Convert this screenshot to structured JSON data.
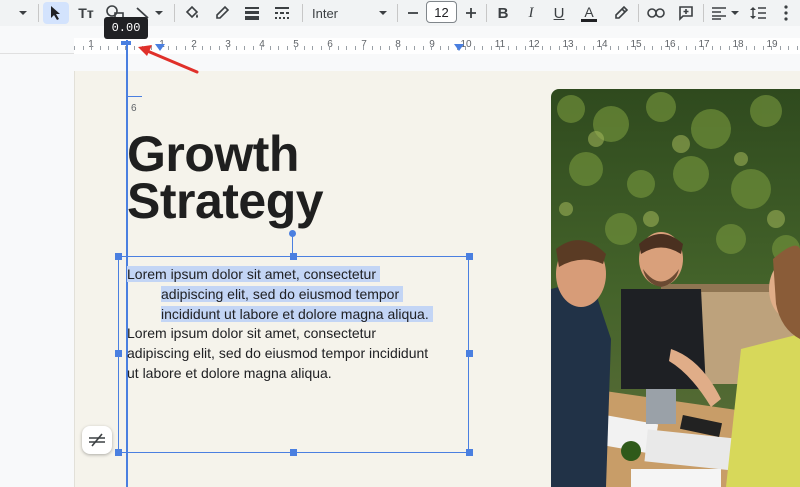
{
  "toolbar": {
    "font_name": "Inter",
    "font_size": "12",
    "tools": [
      "menu-caret",
      "select",
      "text-box",
      "shape",
      "line",
      "fill-color",
      "border-color",
      "border-weight",
      "border-dash",
      "font",
      "decrease-size",
      "increase-size",
      "bold",
      "italic",
      "underline",
      "text-color",
      "highlight",
      "link",
      "comment",
      "align",
      "line-spacing"
    ],
    "bold_label": "B",
    "italic_label": "I",
    "underline_label": "U",
    "text_color_label": "A",
    "text_tool_label": "Tт"
  },
  "tooltip": {
    "value": "0.00"
  },
  "ruler": {
    "labels": [
      "1",
      "1",
      "2",
      "3",
      "4",
      "5",
      "6",
      "7",
      "8",
      "9",
      "10",
      "11",
      "12",
      "13",
      "14",
      "15",
      "16",
      "17",
      "18",
      "19"
    ]
  },
  "slide": {
    "marker_value": "6",
    "title_line1": "Growth",
    "title_line2": "Strategy",
    "paragraph1": {
      "line1": "Lorem ipsum dolor sit amet, consectetur",
      "line2": "adipiscing elit, sed do eiusmod tempor",
      "line3": "incididunt ut labore et dolore magna aliqua."
    },
    "paragraph2": {
      "line1": "Lorem ipsum dolor sit amet, consectetur",
      "line2": "adipiscing elit, sed do eiusmod tempor incididunt",
      "line3": "ut labore et dolore magna aliqua."
    }
  },
  "colors": {
    "accent": "#4a7fe0",
    "selection": "#c3d5f5",
    "slide_bg": "#f5f3eb",
    "annotation_arrow": "#e0302a"
  }
}
